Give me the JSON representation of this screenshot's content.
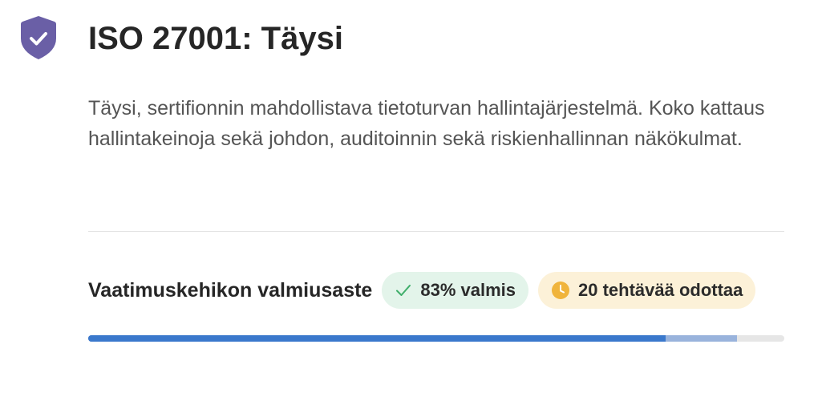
{
  "header": {
    "icon": "shield-check-icon",
    "icon_color": "#6a5fa6",
    "title": "ISO 27001: Täysi"
  },
  "description": "Täysi, sertifionnin mahdollistava tietoturvan hallintajärjestelmä. Koko kattaus hallintakeinoja sekä johdon, auditoinnin sekä riskienhallinnan näkökulmat.",
  "readiness": {
    "label": "Vaatimuskehikon valmiusaste",
    "ready_badge": {
      "icon": "check-icon",
      "text": "83% valmis",
      "color": "#3fae6a"
    },
    "pending_badge": {
      "icon": "clock-icon",
      "text": "20 tehtävää odottaa",
      "color": "#f0b43c"
    },
    "progress": {
      "done_fraction": 0.83,
      "pending_fraction": 0.17,
      "done_color": "#3a78cc",
      "pending_color": "#99b3dc",
      "track_color": "#e6e6e6"
    }
  }
}
